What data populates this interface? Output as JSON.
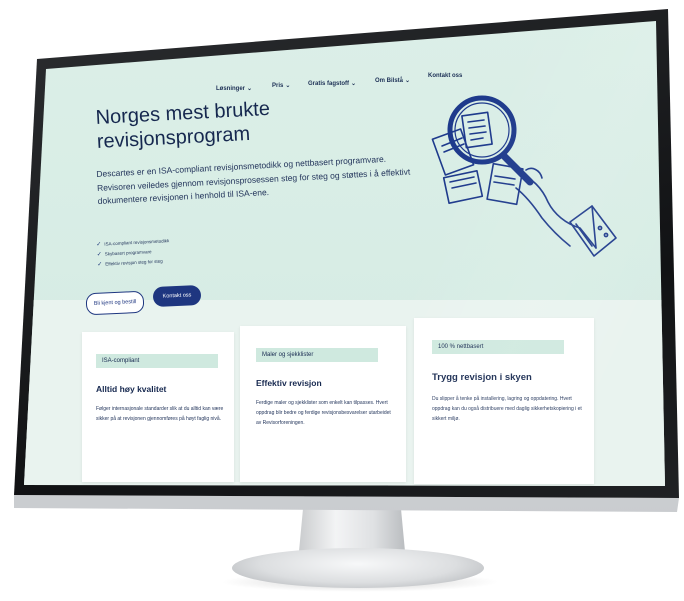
{
  "nav": {
    "items": [
      {
        "label": "Løsninger",
        "chev": "⌄"
      },
      {
        "label": "Pris",
        "chev": "⌄"
      },
      {
        "label": "Gratis fagstoff",
        "chev": "⌄"
      },
      {
        "label": "Om Bilstå",
        "chev": "⌄"
      },
      {
        "label": "Kontakt oss",
        "chev": ""
      }
    ]
  },
  "hero": {
    "title_line1": "Norges mest brukte",
    "title_line2": "revisjonsprogram",
    "description": "Descartes er en ISA-compliant revisjonsmetodikk og nettbasert programvare. Revisoren veiledes gjennom revisjonsprosessen steg for steg og støttes i å effektivt dokumentere revisjonen i henhold til ISA-ene.",
    "checks": [
      "ISA-compliant revisjonsmetodikk",
      "Skybasert programvare",
      "Effektiv revisjon steg for steg"
    ],
    "tick": "✓",
    "btn_outline": "Bli kjent og bestill",
    "btn_solid": "Kontakt oss"
  },
  "cards": [
    {
      "tag": "ISA-compliant",
      "title": "Alltid høy kvalitet",
      "text": "Følger internasjonale standarder slik at du alltid kan være sikker på at revisjonen gjennomføres på høyt faglig nivå."
    },
    {
      "tag": "Maler og sjekklister",
      "title": "Effektiv revisjon",
      "text": "Ferdige maler og sjekklister som enkelt kan tilpasses. Hvert oppdrag blir bedre og ferdige revisjonsbesvarelser utarbeidet av Revisorforeningen."
    },
    {
      "tag": "100 % nettbasert",
      "title": "Trygg revisjon i skyen",
      "text": "Du slipper å tenke på installering, lagring og oppdatering. Hvert oppdrag kan du også distribuere med daglig sikkerhetskopiering i et sikkert miljø."
    }
  ],
  "colors": {
    "screen_bg": "#d6ece4",
    "brand_navy": "#1e3680",
    "tag_bg": "#cfe9df",
    "text": "#16284f"
  },
  "icons": {
    "illustration": "hand-magnifying-glass-documents"
  }
}
